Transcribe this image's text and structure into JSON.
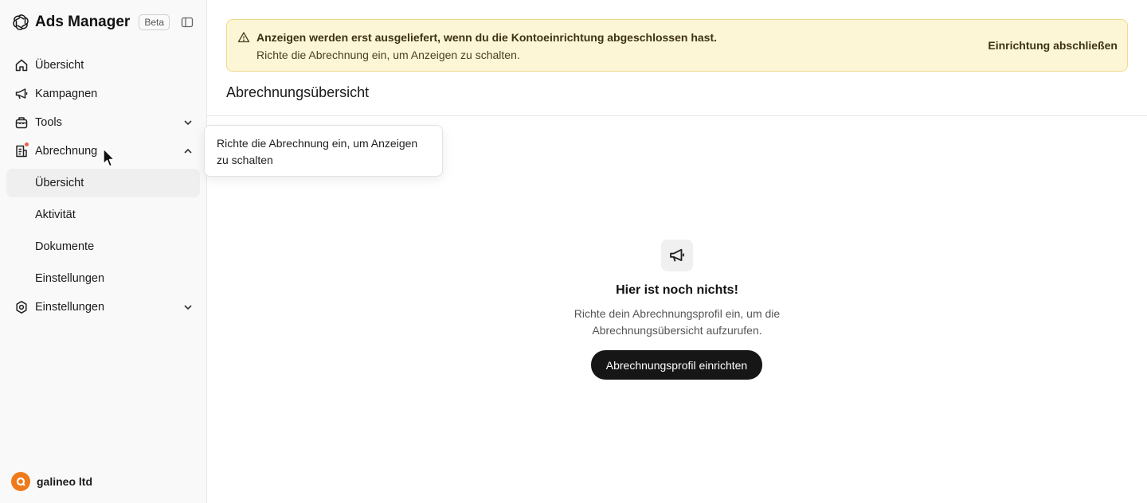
{
  "app": {
    "title": "Ads Manager",
    "badge": "Beta"
  },
  "sidebar": {
    "items": [
      {
        "label": "Übersicht",
        "icon": "home-icon"
      },
      {
        "label": "Kampagnen",
        "icon": "megaphone-icon"
      },
      {
        "label": "Tools",
        "icon": "toolbox-icon",
        "expanded": false
      },
      {
        "label": "Abrechnung",
        "icon": "receipt-icon",
        "expanded": true,
        "notification": true
      },
      {
        "label": "Einstellungen",
        "icon": "gear-icon",
        "expanded": false
      }
    ],
    "billing_subitems": [
      {
        "label": "Übersicht",
        "active": true
      },
      {
        "label": "Aktivität"
      },
      {
        "label": "Dokumente"
      },
      {
        "label": "Einstellungen"
      }
    ],
    "account": {
      "name": "galineo ltd",
      "avatar_color": "#f07a1a"
    }
  },
  "alert": {
    "title": "Anzeigen werden erst ausgeliefert, wenn du die Kontoeinrichtung abgeschlossen hast.",
    "text": "Richte die Abrechnung ein, um Anzeigen zu schalten.",
    "action": "Einrichtung abschließen",
    "background": "#fdf6d6"
  },
  "page": {
    "title": "Abrechnungsübersicht"
  },
  "empty_state": {
    "icon": "megaphone-icon",
    "title": "Hier ist noch nichts!",
    "text": "Richte dein Abrechnungsprofil ein, um die Abrechnungsübersicht aufzurufen.",
    "button": "Abrechnungsprofil einrichten"
  },
  "tooltip": {
    "text": "Richte die Abrechnung ein, um Anzeigen zu schalten"
  }
}
